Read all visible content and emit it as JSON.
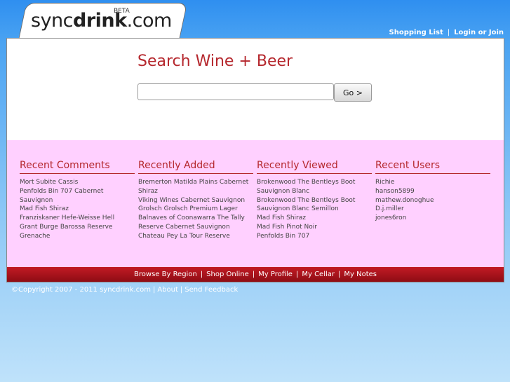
{
  "logo": {
    "prefix": "sync",
    "bold": "drink",
    "suffix": ".com",
    "beta": "BETA"
  },
  "top_links": {
    "shopping_list": "Shopping List",
    "login": "Login or Join"
  },
  "search": {
    "title": "Search Wine + Beer",
    "value": "",
    "go_label": "Go >"
  },
  "columns": [
    {
      "title": "Recent Comments",
      "items": [
        "Mort Subite Cassis",
        "Penfolds Bin 707 Cabernet",
        "Sauvignon",
        "Mad Fish Shiraz",
        "Franziskaner Hefe-Weisse Hell",
        "Grant Burge Barossa Reserve",
        "Grenache"
      ]
    },
    {
      "title": "Recently Added",
      "items": [
        "Bremerton Matilda Plains Cabernet",
        "Shiraz",
        "Viking Wines Cabernet Sauvignon",
        "Grolsch Grolsch Premium Lager",
        "Balnaves of Coonawarra The Tally",
        "Reserve Cabernet Sauvignon",
        "Chateau Pey La Tour Reserve"
      ]
    },
    {
      "title": "Recently Viewed",
      "items": [
        "Brokenwood The Bentleys Boot",
        "Sauvignon Blanc",
        "Brokenwood The Bentleys Boot",
        "Sauvignon Blanc Semillon",
        "Mad Fish Shiraz",
        "Mad Fish Pinot Noir",
        "Penfolds Bin 707"
      ]
    },
    {
      "title": "Recent Users",
      "items": [
        "Richie",
        "hanson5899",
        "mathew.donoghue",
        "D.j.miller",
        "jones6ron"
      ]
    }
  ],
  "footer_nav": [
    "Browse By Region",
    "Shop Online",
    "My Profile",
    "My Cellar",
    "My Notes"
  ],
  "copyright": {
    "text": "©Copyright 2007 - 2011 syncdrink.com",
    "about": "About",
    "feedback": "Send Feedback"
  },
  "colors": {
    "accent": "#b5272d",
    "pink_band": "#ffd0ff",
    "footer_red": "#b0141c"
  }
}
